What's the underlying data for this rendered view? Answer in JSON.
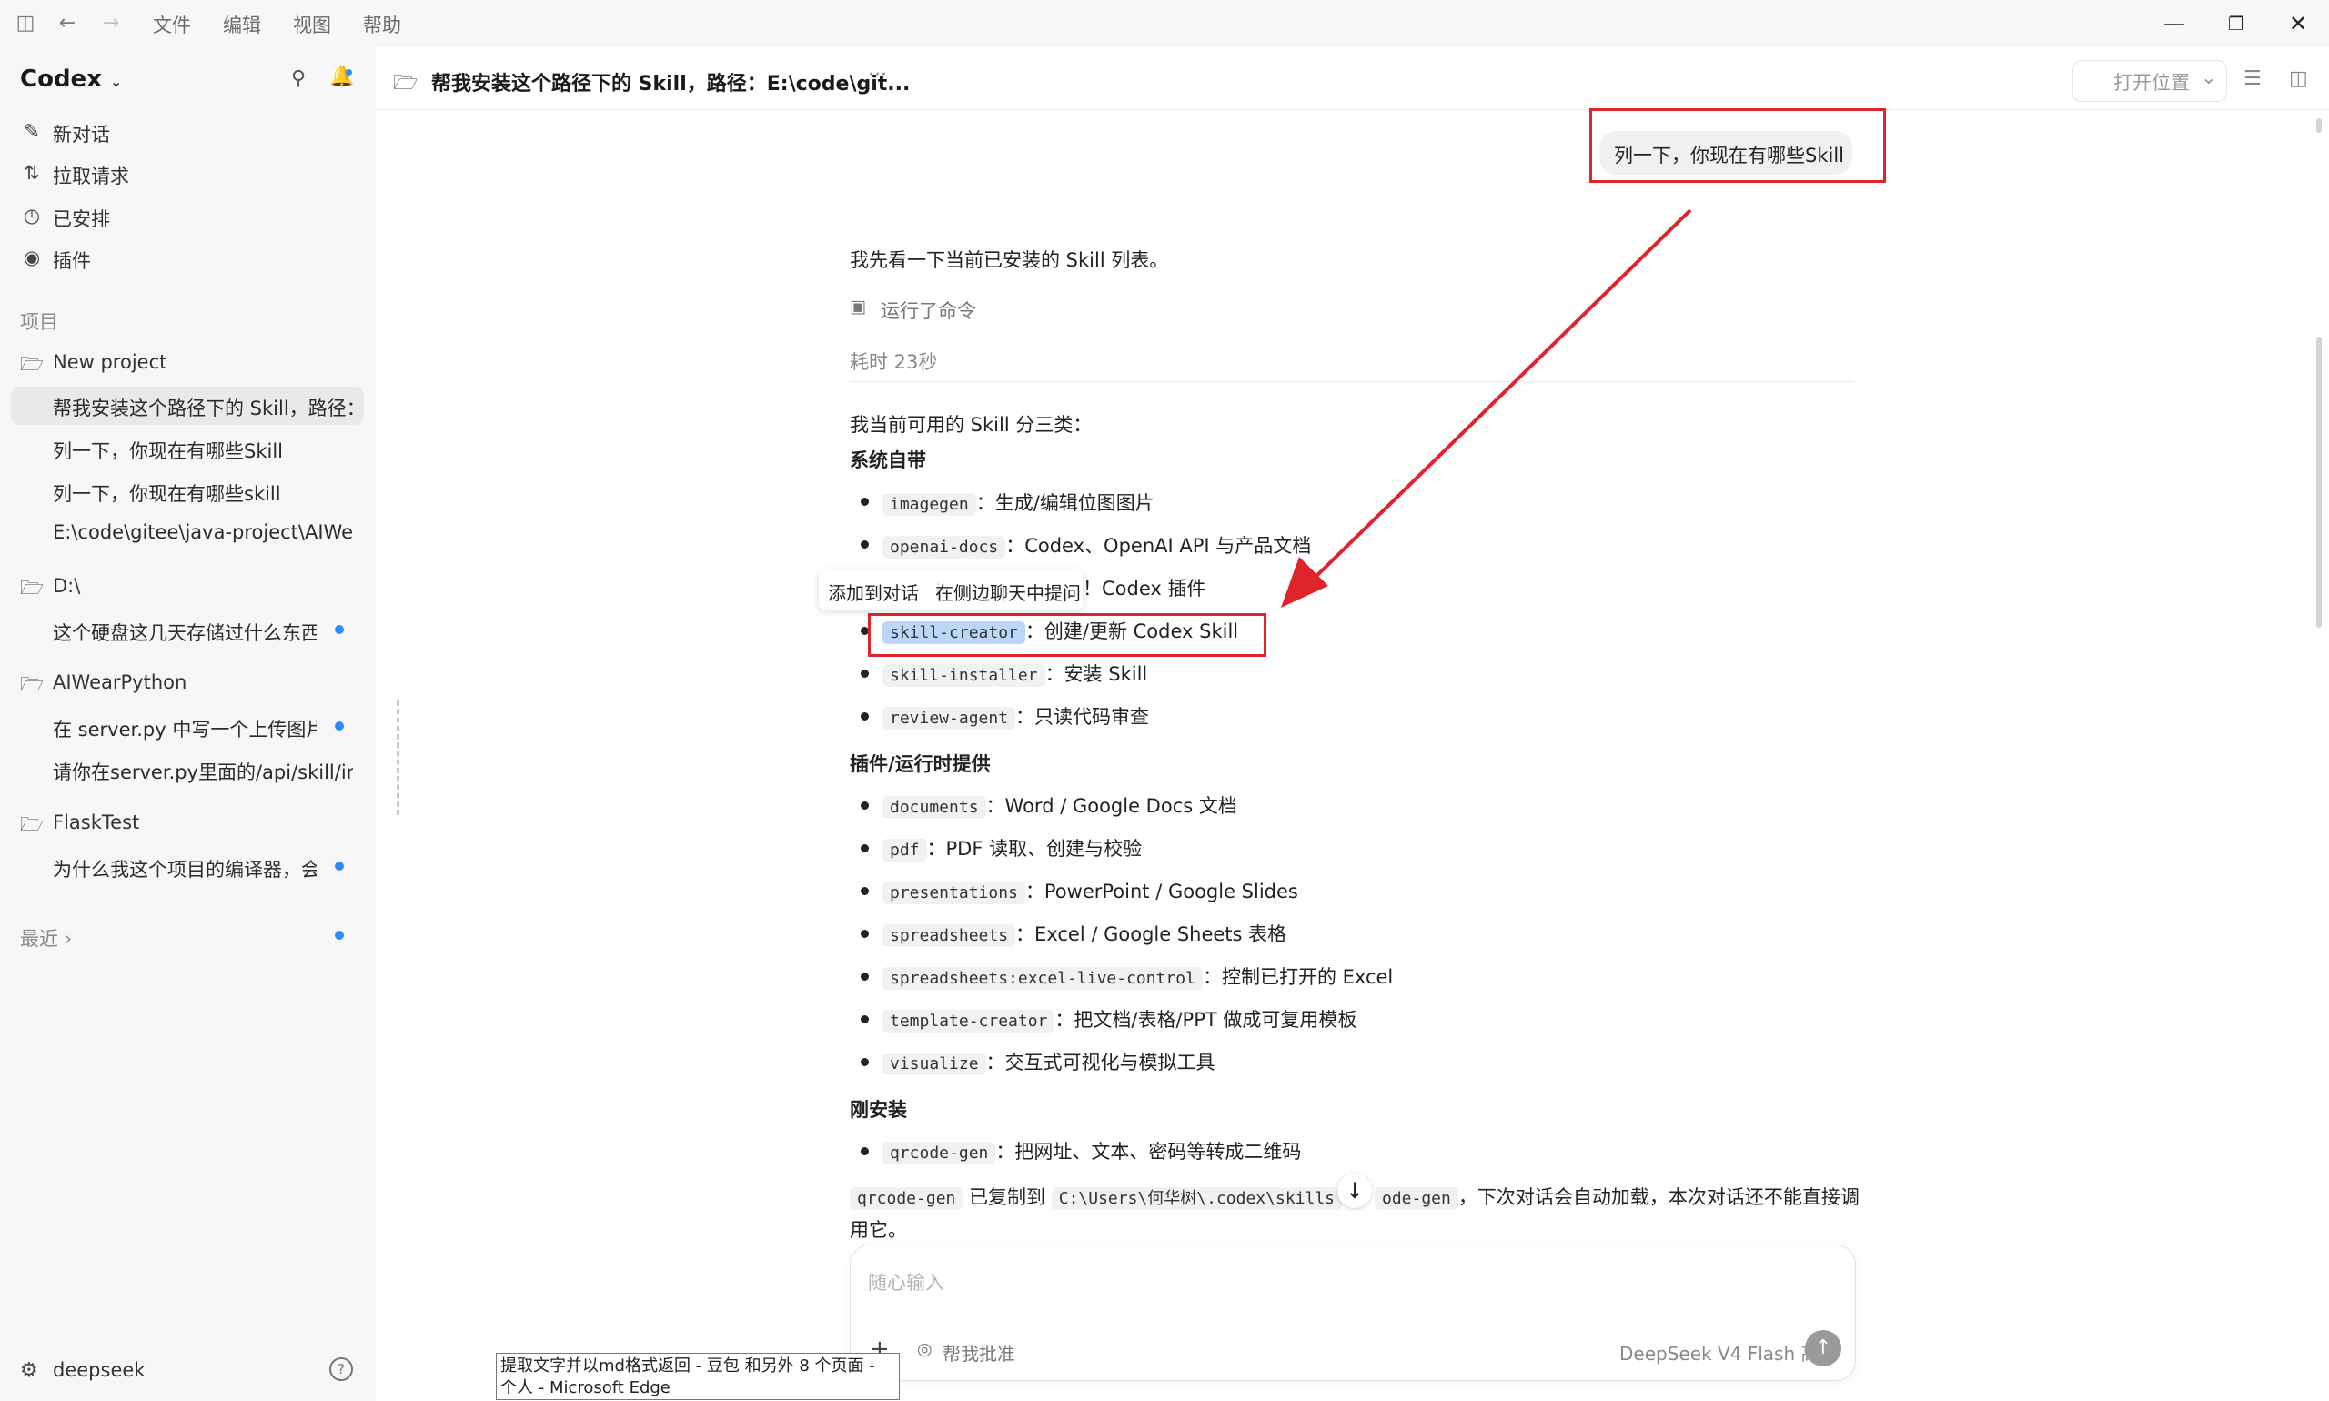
{
  "titlebar": {
    "menu": [
      "文件",
      "编辑",
      "视图",
      "帮助"
    ],
    "window_controls": [
      "minimize-icon",
      "restore-icon",
      "close-icon"
    ]
  },
  "sidebar": {
    "app_name": "Codex",
    "nav": [
      {
        "label": "新对话",
        "icon": "edit-icon"
      },
      {
        "label": "拉取请求",
        "icon": "pull-request-icon"
      },
      {
        "label": "已安排",
        "icon": "clock-icon"
      },
      {
        "label": "插件",
        "icon": "plugin-icon"
      }
    ],
    "projects_heading": "项目",
    "projects": [
      {
        "name": "New project",
        "threads": [
          {
            "title": "帮我安装这个路径下的 Skill，路径：",
            "selected": true,
            "unread": false
          },
          {
            "title": "列一下，你现在有哪些Skill",
            "selected": false,
            "unread": false
          },
          {
            "title": "列一下，你现在有哪些skill",
            "selected": false,
            "unread": false
          },
          {
            "title": "E:\\code\\gitee\\java-project\\AIWear-",
            "selected": false,
            "unread": false
          }
        ]
      },
      {
        "name": "D:\\",
        "threads": [
          {
            "title": "这个硬盘这几天存储过什么东西",
            "selected": false,
            "unread": true
          }
        ]
      },
      {
        "name": "AIWearPython",
        "threads": [
          {
            "title": "在 server.py 中写一个上传图片",
            "selected": false,
            "unread": true
          },
          {
            "title": "请你在server.py里面的/api/skill/ima",
            "selected": false,
            "unread": false
          }
        ]
      },
      {
        "name": "FlaskTest",
        "threads": [
          {
            "title": "为什么我这个项目的编译器，会",
            "selected": false,
            "unread": true
          }
        ]
      }
    ],
    "recent_label": "最近",
    "user_name": "deepseek"
  },
  "header": {
    "title": "帮我安装这个路径下的 Skill，路径：E:\\code\\git...",
    "more": "···",
    "open_location": "打开位置"
  },
  "chat": {
    "user_message": "列一下，你现在有哪些Skill",
    "intro": "我先看一下当前已安装的 Skill 列表。",
    "ran_command": "运行了命令",
    "elapsed": "耗时 23秒",
    "summary": "我当前可用的 Skill 分三类：",
    "sections": [
      {
        "heading": "系统自带",
        "items": [
          {
            "code": "imagegen",
            "desc": "：生成/编辑位图图片"
          },
          {
            "code": "openai-docs",
            "desc": "：Codex、OpenAI API 与产品文档"
          },
          {
            "code": "",
            "desc": "！Codex 插件"
          },
          {
            "code": "skill-creator",
            "desc": "：创建/更新 Codex Skill"
          },
          {
            "code": "skill-installer",
            "desc": "：安装 Skill"
          },
          {
            "code": "review-agent",
            "desc": "：只读代码审查"
          }
        ]
      },
      {
        "heading": "插件/运行时提供",
        "items": [
          {
            "code": "documents",
            "desc": "：Word / Google Docs 文档"
          },
          {
            "code": "pdf",
            "desc": "：PDF 读取、创建与校验"
          },
          {
            "code": "presentations",
            "desc": "：PowerPoint / Google Slides"
          },
          {
            "code": "spreadsheets",
            "desc": "：Excel / Google Sheets 表格"
          },
          {
            "code": "spreadsheets:excel-live-control",
            "desc": "：控制已打开的 Excel"
          },
          {
            "code": "template-creator",
            "desc": "：把文档/表格/PPT 做成可复用模板"
          },
          {
            "code": "visualize",
            "desc": "：交互式可视化与模拟工具"
          }
        ]
      },
      {
        "heading": "刚安装",
        "items": [
          {
            "code": "qrcode-gen",
            "desc": "：把网址、文本、密码等转成二维码"
          }
        ]
      }
    ],
    "footer_code1": "qrcode-gen",
    "footer_text1": "已复制到",
    "footer_path": "C:\\Users\\何华树\\.codex\\skills",
    "footer_code2": "ode-gen",
    "footer_text2": "，下次对话会自动加载，本次对话还不能直接调",
    "footer_text3": "用它。"
  },
  "tooltip": {
    "add_to_chat": "添加到对话",
    "ask_side": "在侧边聊天中提问"
  },
  "input": {
    "placeholder": "随心输入",
    "plus": "+",
    "approve_label": "帮我批准",
    "model": "DeepSeek V4 Flash",
    "effort": "高"
  },
  "taskbar_tooltip": "提取文字并以md格式返回 - 豆包 和另外 8 个页面 - 个人 - Microsoft Edge",
  "colors": {
    "annotation_red": "#e0242b",
    "unread_dot": "#2f8cf6",
    "selection_highlight": "#bcd6f7"
  }
}
